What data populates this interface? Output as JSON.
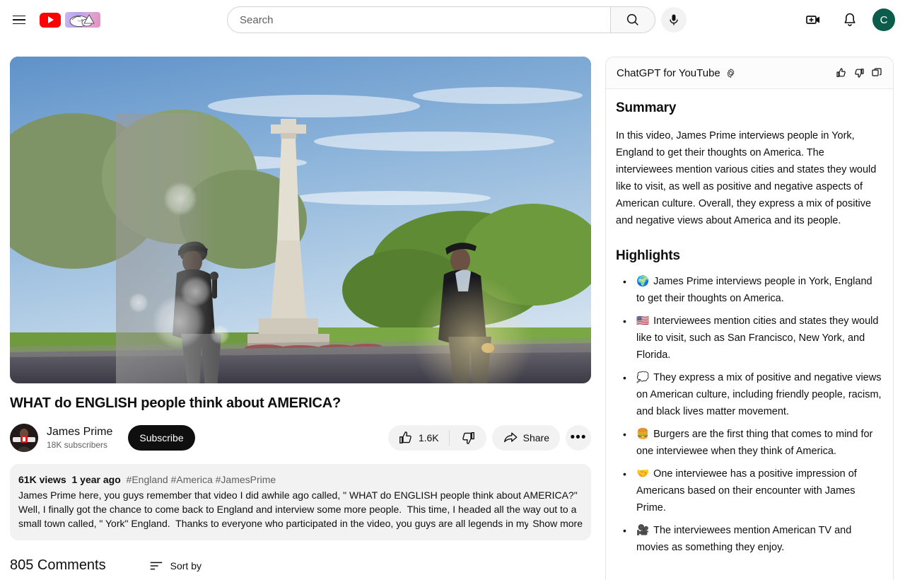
{
  "header": {
    "menu_icon": "hamburger-menu-icon",
    "logo_icon": "youtube-logo-icon",
    "doodle_icon": "youtube-doodle-sleeping-cat-icon",
    "search": {
      "placeholder": "Search",
      "value": "",
      "button_icon": "search-icon"
    },
    "mic_icon": "microphone-icon",
    "create_icon": "create-video-icon",
    "notifications_icon": "notification-bell-icon",
    "avatar_letter": "C",
    "avatar_color": "#0b5c4a"
  },
  "video": {
    "title": "WHAT do ENGLISH people think about AMERICA?",
    "channel": {
      "name": "James Prime",
      "subscribers": "18K subscribers"
    },
    "subscribe_label": "Subscribe",
    "actions": {
      "like_count": "1.6K",
      "like_icon": "thumbs-up-icon",
      "dislike_icon": "thumbs-down-icon",
      "share_label": "Share",
      "share_icon": "share-arrow-icon",
      "more_label": "•••"
    },
    "description": {
      "views": "61K views",
      "age": "1 year ago",
      "hashtags": "#England #America #JamesPrime",
      "body": "James Prime here, you guys remember that video I did awhile ago called, \" WHAT do ENGLISH people think about AMERICA?\"  Well, I finally got the chance to come back to England and interview some more people.  This time, I headed all the way out to a small town called, \" York\" England.  Thanks to everyone who participated in the video, you guys are all legends in my",
      "show_more_label": "Show more"
    }
  },
  "comments": {
    "count_label": "805 Comments",
    "sort_label": "Sort by",
    "sort_icon": "sort-lines-icon"
  },
  "panel": {
    "title": "ChatGPT for YouTube",
    "gear_icon": "gear-icon",
    "like_icon": "thumbs-up-icon",
    "dislike_icon": "thumbs-down-icon",
    "copy_icon": "copy-icon",
    "summary_heading": "Summary",
    "summary_text": "In this video, James Prime interviews people in York, England to get their thoughts on America. The interviewees mention various cities and states they would like to visit, as well as positive and negative aspects of American culture. Overall, they express a mix of positive and negative views about America and its people.",
    "highlights_heading": "Highlights",
    "highlights": [
      {
        "emoji": "🌍",
        "text": "James Prime interviews people in York, England to get their thoughts on America."
      },
      {
        "emoji": "🇺🇸",
        "text": "Interviewees mention cities and states they would like to visit, such as San Francisco, New York, and Florida."
      },
      {
        "emoji": "💭",
        "text": "They express a mix of positive and negative views on American culture, including friendly people, racism, and black lives matter movement."
      },
      {
        "emoji": "🍔",
        "text": "Burgers are the first thing that comes to mind for one interviewee when they think of America."
      },
      {
        "emoji": "🤝",
        "text": "One interviewee has a positive impression of Americans based on their encounter with James Prime."
      },
      {
        "emoji": "🎥",
        "text": "The interviewees mention American TV and movies as something they enjoy."
      }
    ]
  }
}
